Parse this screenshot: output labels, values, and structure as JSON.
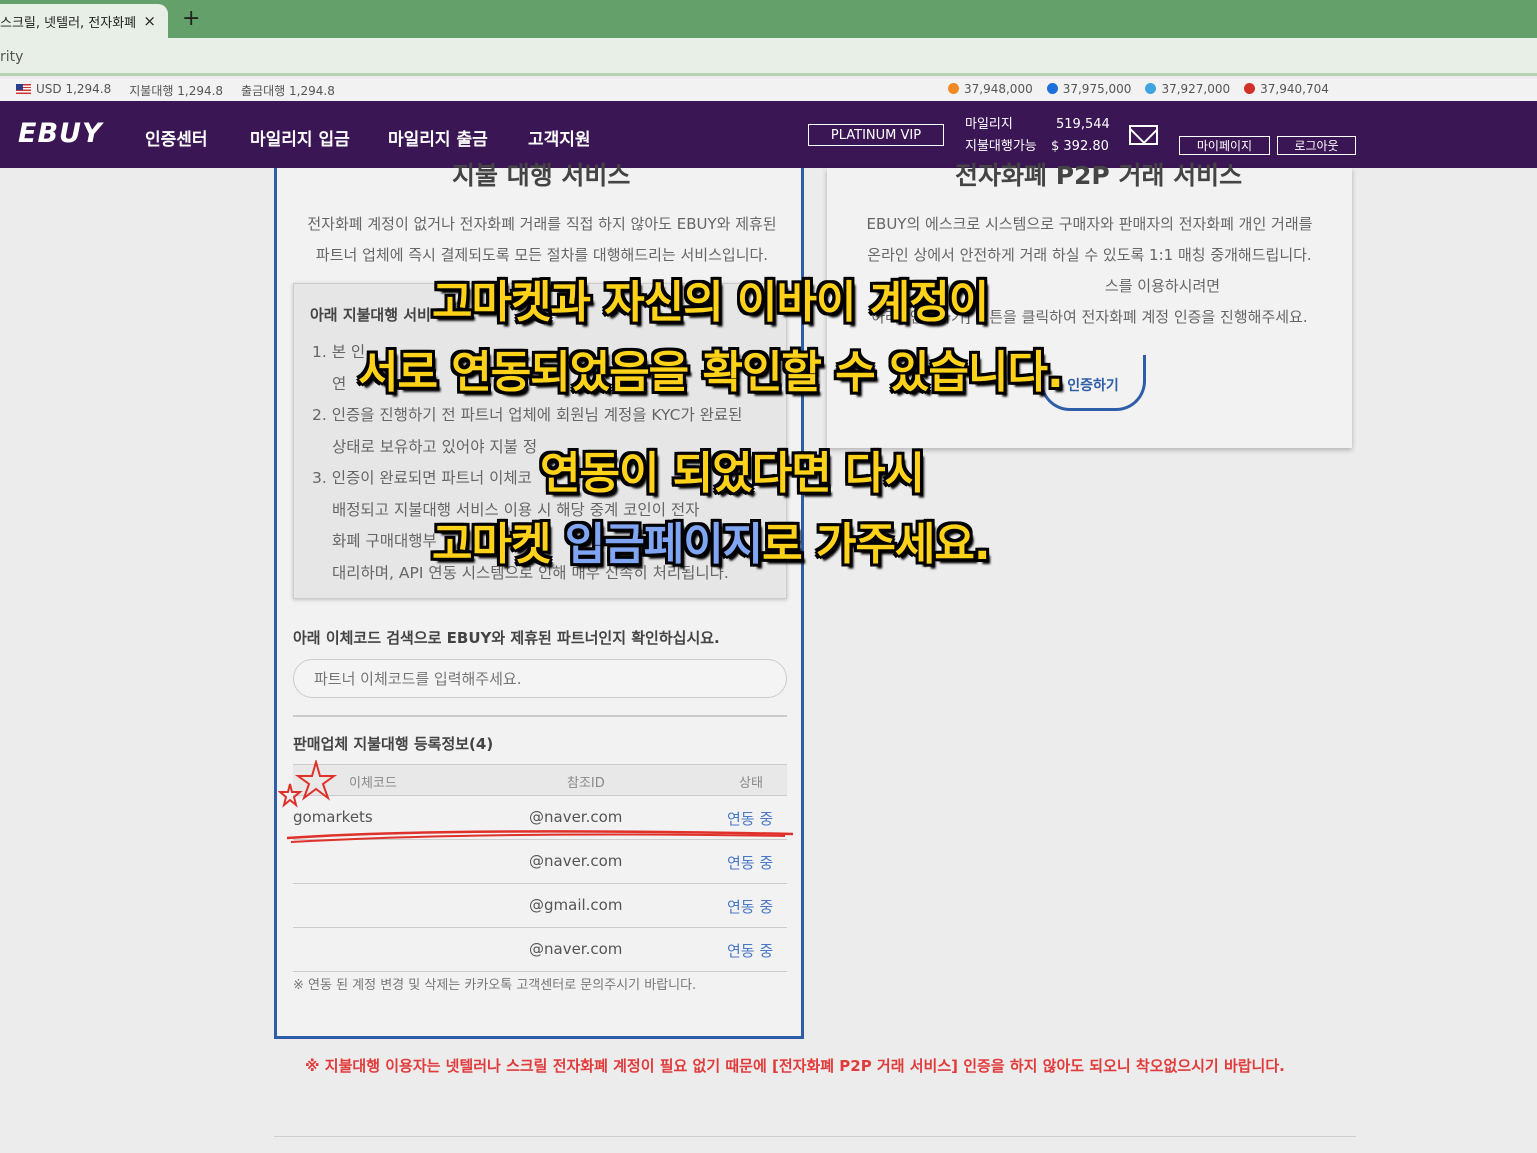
{
  "browser": {
    "tab_title": "스크릴, 넷텔러, 전자화폐",
    "tab_close": "×",
    "new_tab": "+",
    "url_fragment": "rity"
  },
  "infostrip": {
    "rates": [
      "USD 1,294.8",
      "지불대행 1,294.8",
      "출금대행 1,294.8"
    ],
    "coins": [
      {
        "value": "37,948,000",
        "color": "#f08a24"
      },
      {
        "value": "37,975,000",
        "color": "#1d6fdc"
      },
      {
        "value": "37,927,000",
        "color": "#3fa4e0"
      },
      {
        "value": "37,940,704",
        "color": "#d2302a"
      }
    ]
  },
  "navbar": {
    "logo": "EBUY",
    "menu": [
      "인증센터",
      "마일리지 입금",
      "마일리지 출금",
      "고객지원"
    ],
    "vip": "PLATINUM VIP",
    "mileage_label": "마일리지",
    "mileage_value": "519,544",
    "payable_label": "지불대행가능",
    "payable_value": "$ 392.80",
    "mypage": "마이페이지",
    "logout": "로그아웃"
  },
  "left_panel": {
    "title": "지불 대행 서비스",
    "desc1": "전자화폐 계정이 없거나 전자화폐 거래를 직접 하지 않아도 EBUY와 제휴된",
    "desc2": "파트너 업체에 즉시 결제되도록 모든 절차를 대행해드리는 서비스입니다.",
    "info_title": "아래 지불대행 서비",
    "steps": [
      "1. 본 인",
      "연",
      "2. 인증을 진행하기 전 파트너 업체에 회원님 계정을 KYC가 완료된",
      "상태로 보유하고 있어야 지불 정",
      "3. 인증이 완료되면 파트너 이체코",
      "배정되고 지불대행 서비스 이용 시 해당 중계 코인이 전자",
      "화폐 구매대행부",
      "대리하며, API 연동 시스템으로 인해 매우 신속히 처리됩니다."
    ],
    "search_label": "아래 이체코드 검색으로 EBUY와 제휴된 파트너인지 확인하십시요.",
    "search_placeholder": "파트너 이체코드를 입력해주세요.",
    "reg_title": "판매업체 지불대행 등록정보(4)",
    "columns": [
      "이체코드",
      "참조ID",
      "상태"
    ],
    "rows": [
      {
        "code": "gomarkets",
        "ref": "@naver.com",
        "status": "연동 중"
      },
      {
        "code": "",
        "ref": "@naver.com",
        "status": "연동 중"
      },
      {
        "code": "",
        "ref": "@gmail.com",
        "status": "연동 중"
      },
      {
        "code": "",
        "ref": "@naver.com",
        "status": "연동 중"
      }
    ],
    "note": "※ 연동 된 계정 변경 및 삭제는 카카오톡 고객센터로 문의주시기 바랍니다."
  },
  "right_panel": {
    "title": "전자화폐 P2P 거래 서비스",
    "desc1": "EBUY의 에스크로 시스템으로 구매자와 판매자의 전자화폐 개인 거래를",
    "desc2": "온라인 상에서 안전하게 거래 하실 수 있도록 1:1 매칭 중개해드립니다.",
    "desc3": "스를 이용하시려면",
    "desc4": "아래 [인증하기] 버튼을 클릭하여 전자화폐 계정 인증을 진행해주세요.",
    "button": "인증하기"
  },
  "bottom_note": "※ 지불대행 이용자는 넷텔러나 스크릴 전자화폐 계정이 필요 없기 때문에 [전자화폐 P2P 거래 서비스] 인증을 하지 않아도 되오니 착오없으시기 바랍니다.",
  "overlay": {
    "line1": "고마켓과 자신의 이바이 계정이",
    "line2": "서로 연동되었음을 확인할 수 있습니다.",
    "line3": "연동이 되었다면 다시",
    "line4_a": "고마켓 ",
    "line4_b": "입금페이지",
    "line4_c": "로 가주세요."
  }
}
